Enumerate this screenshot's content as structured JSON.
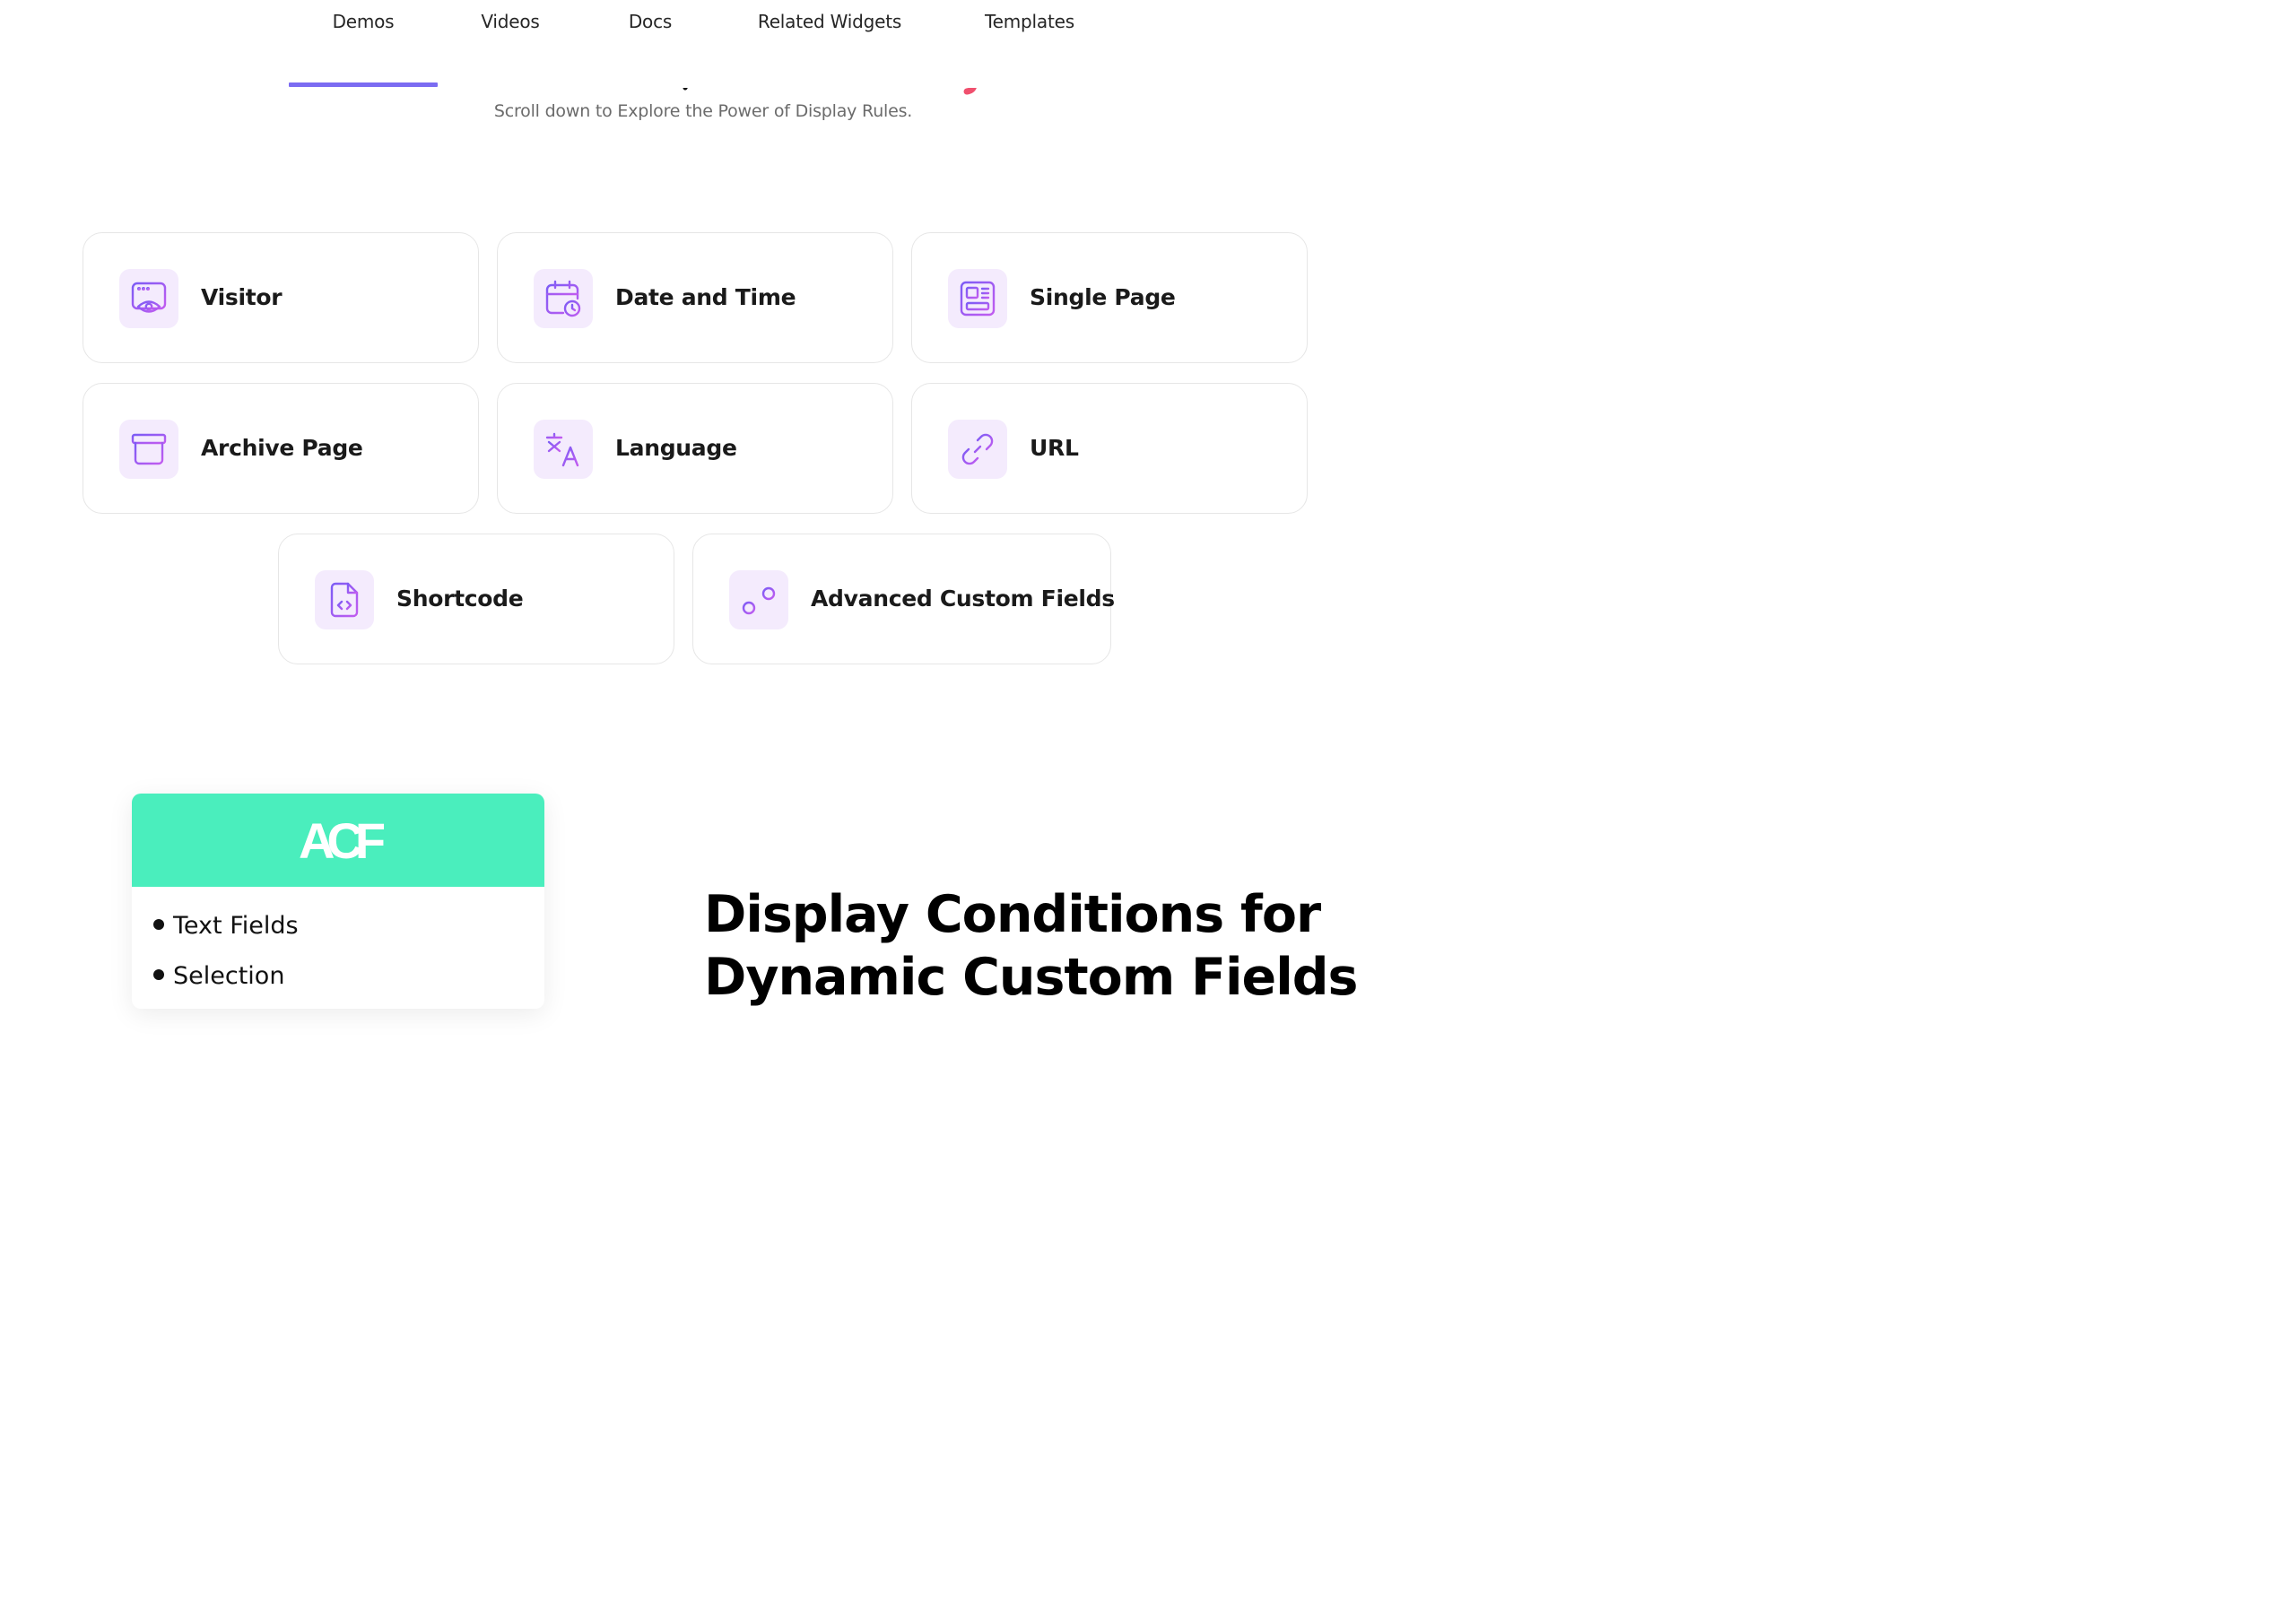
{
  "tabs": [
    {
      "label": "Demos",
      "active": true
    },
    {
      "label": "Videos",
      "active": false
    },
    {
      "label": "Docs",
      "active": false
    },
    {
      "label": "Related Widgets",
      "active": false
    },
    {
      "label": "Templates",
      "active": false
    }
  ],
  "subtitle": "Scroll down to Explore the Power of Display Rules.",
  "conditions": [
    {
      "label": "Visitor",
      "icon": "eye-window-icon"
    },
    {
      "label": "Date and Time",
      "icon": "calendar-clock-icon"
    },
    {
      "label": "Single Page",
      "icon": "document-layout-icon"
    },
    {
      "label": "Archive Page",
      "icon": "archive-box-icon"
    },
    {
      "label": "Language",
      "icon": "translate-icon"
    },
    {
      "label": "URL",
      "icon": "link-icon"
    },
    {
      "label": "Shortcode",
      "icon": "code-file-icon"
    },
    {
      "label": "Advanced Custom Fields",
      "icon": "sliders-icon"
    }
  ],
  "acf": {
    "logo_text": "ACF",
    "items": [
      "Text Fields",
      "Selection"
    ]
  },
  "section_title_line1": "Display Conditions for",
  "section_title_line2": "Dynamic Custom Fields",
  "colors": {
    "accent": "#7b6cf2",
    "icon_bg": "#f4ebfd",
    "acf_green": "#4aeebd",
    "icon_gradient_start": "#7c5cf5",
    "icon_gradient_end": "#c25cf0"
  }
}
